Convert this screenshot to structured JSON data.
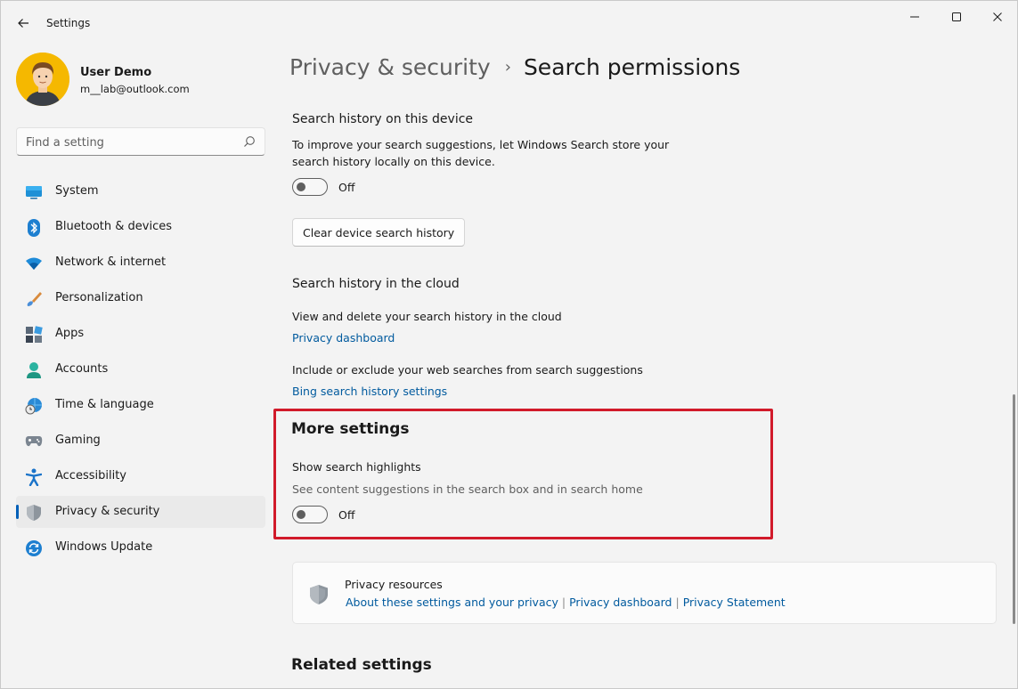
{
  "window": {
    "title": "Settings"
  },
  "user": {
    "name": "User Demo",
    "email": "m__lab@outlook.com"
  },
  "search": {
    "placeholder": "Find a setting"
  },
  "sidebar": {
    "items": [
      {
        "label": "System",
        "icon": "monitor-icon"
      },
      {
        "label": "Bluetooth & devices",
        "icon": "bluetooth-icon"
      },
      {
        "label": "Network & internet",
        "icon": "wifi-icon"
      },
      {
        "label": "Personalization",
        "icon": "brush-icon"
      },
      {
        "label": "Apps",
        "icon": "apps-icon"
      },
      {
        "label": "Accounts",
        "icon": "person-icon"
      },
      {
        "label": "Time & language",
        "icon": "globe-clock-icon"
      },
      {
        "label": "Gaming",
        "icon": "gamepad-icon"
      },
      {
        "label": "Accessibility",
        "icon": "accessibility-icon"
      },
      {
        "label": "Privacy & security",
        "icon": "shield-icon",
        "selected": true
      },
      {
        "label": "Windows Update",
        "icon": "sync-icon"
      }
    ]
  },
  "breadcrumb": {
    "parent": "Privacy & security",
    "separator": "›",
    "current": "Search permissions"
  },
  "device_history": {
    "title": "Search history on this device",
    "description_line1": "To improve your search suggestions, let Windows Search store your",
    "description_line2": "search history locally on this device.",
    "toggle_state": "Off",
    "clear_button": "Clear device search history"
  },
  "cloud_history": {
    "title": "Search history in the cloud",
    "view_text": "View and delete your search history in the cloud",
    "privacy_dashboard_link": "Privacy dashboard",
    "include_text": "Include or exclude your web searches from search suggestions",
    "bing_link": "Bing search history settings"
  },
  "more_settings": {
    "title": "More settings",
    "highlights_title": "Show search highlights",
    "highlights_desc": "See content suggestions in the search box and in search home",
    "toggle_state": "Off"
  },
  "privacy_resources": {
    "title": "Privacy resources",
    "link1": "About these settings and your privacy",
    "link2": "Privacy dashboard",
    "link3": "Privacy Statement",
    "separator": "|"
  },
  "related_settings": {
    "title": "Related settings"
  },
  "colors": {
    "accent": "#005fb8",
    "link": "#005a9e",
    "highlight_border": "#d11a2a",
    "avatar_bg": "#f5b800"
  }
}
